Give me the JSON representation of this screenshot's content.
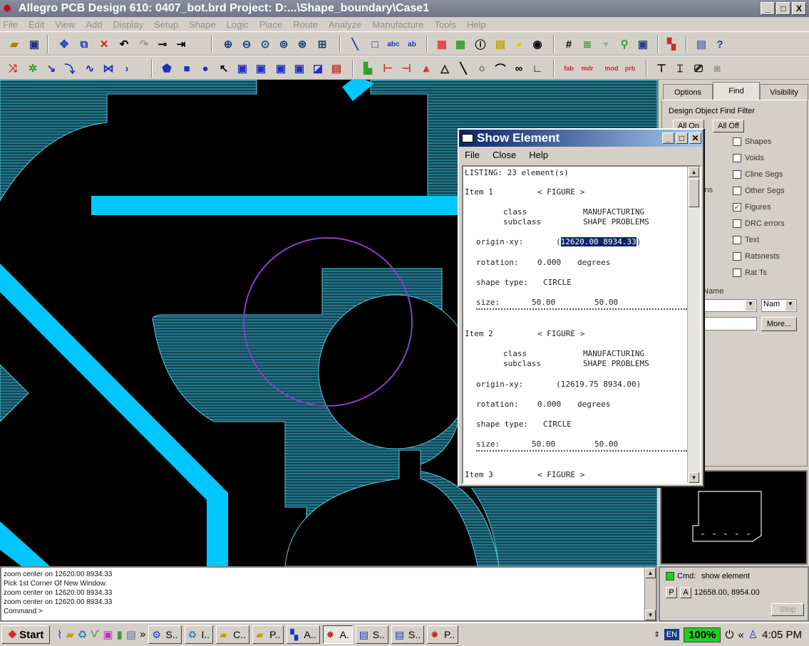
{
  "window": {
    "title": "Allegro PCB Design 610: 0407_bot.brd  Project: D:...\\Shape_boundary\\Case1",
    "controls": [
      "_",
      "□",
      "X"
    ]
  },
  "menu": [
    "File",
    "Edit",
    "View",
    "Add",
    "Display",
    "Setup",
    "Shape",
    "Logic",
    "Place",
    "Route",
    "Analyze",
    "Manufacture",
    "Tools",
    "Help"
  ],
  "toolbar_text": {
    "fab": "fab",
    "mdr": "mdr",
    "mod": "mod",
    "prb": "prb"
  },
  "options_panel": {
    "tabs": [
      "Options",
      "Find",
      "Visibility"
    ],
    "group_title": "Design Object Find Filter",
    "all_on": "All On",
    "all_off": "All Off",
    "checkboxes": [
      {
        "label": "Shapes",
        "checked": false
      },
      {
        "label": "Voids",
        "checked": false
      },
      {
        "label": "Cline Segs",
        "checked": false
      },
      {
        "label": "Other Segs",
        "checked": false
      },
      {
        "label": "Figures",
        "checked": true
      },
      {
        "label": "DRC errors",
        "checked": false
      },
      {
        "label": "Text",
        "checked": false
      },
      {
        "label": "Ratsnests",
        "checked": false
      },
      {
        "label": "Rat Ts",
        "checked": false
      }
    ],
    "left_fragments": [
      "s",
      "s",
      "rs",
      "ions",
      "s"
    ],
    "find_by_name_fragment": "Name",
    "name_select": "Nam",
    "more_button": "More..."
  },
  "dialog": {
    "title": "Show Element",
    "menu": [
      "File",
      "Close",
      "Help"
    ],
    "listing": "LISTING: 23 element(s)",
    "items": [
      {
        "header": "Item 1",
        "type": "< FIGURE >",
        "class_label": "class",
        "class_value": "MANUFACTURING",
        "subclass_label": "subclass",
        "subclass_value": "SHAPE PROBLEMS",
        "origin_label": "origin-xy:",
        "origin_value": "12620.00 8934.33",
        "rotation_label": "rotation:",
        "rotation_value": "0.000",
        "rotation_unit": "degrees",
        "shape_label": "shape type:",
        "shape_value": "CIRCLE",
        "size_label": "size:",
        "size_w": "50.00",
        "size_h": "50.00"
      },
      {
        "header": "Item 2",
        "type": "< FIGURE >",
        "class_label": "class",
        "class_value": "MANUFACTURING",
        "subclass_label": "subclass",
        "subclass_value": "SHAPE PROBLEMS",
        "origin_label": "origin-xy:",
        "origin_value": "(12619.75 8934.00)",
        "rotation_label": "rotation:",
        "rotation_value": "0.000",
        "rotation_unit": "degrees",
        "shape_label": "shape type:",
        "shape_value": "CIRCLE",
        "size_label": "size:",
        "size_w": "50.00",
        "size_h": "50.00"
      },
      {
        "header": "Item 3",
        "type": "< FIGURE >"
      }
    ]
  },
  "console": {
    "lines": [
      "zoom center on 12620.00 8934.33",
      "Pick 1st Corner Of New Window.",
      "zoom center on 12620.00 8934.33",
      "zoom center on 12620.00 8934.33",
      "Command >"
    ]
  },
  "status": {
    "cmd_label": "Cmd:",
    "cmd_value": "show element",
    "p_btn": "P",
    "a_btn": "A",
    "coords": "12658.00, 8954.00",
    "stop": "Stop"
  },
  "taskbar": {
    "start": "Start",
    "quick_more": "»",
    "tasks": [
      {
        "label": "S..",
        "active": false
      },
      {
        "label": "I..",
        "active": false
      },
      {
        "label": "C..",
        "active": false
      },
      {
        "label": "P..",
        "active": false
      },
      {
        "label": "A..",
        "active": false
      },
      {
        "label": "A.",
        "active": true
      },
      {
        "label": "S..",
        "active": false
      },
      {
        "label": "S..",
        "active": false
      },
      {
        "label": "P..",
        "active": false
      }
    ],
    "lang": "EN",
    "zoom": "100%",
    "tray_more": "«",
    "clock": "4:05 PM"
  },
  "colors": {
    "canvas_bg": "#000000",
    "copper": "#00c8ff",
    "shape_fill": "#1a6f82",
    "circle": "#8a3fc8",
    "selection": "#0a246a"
  }
}
